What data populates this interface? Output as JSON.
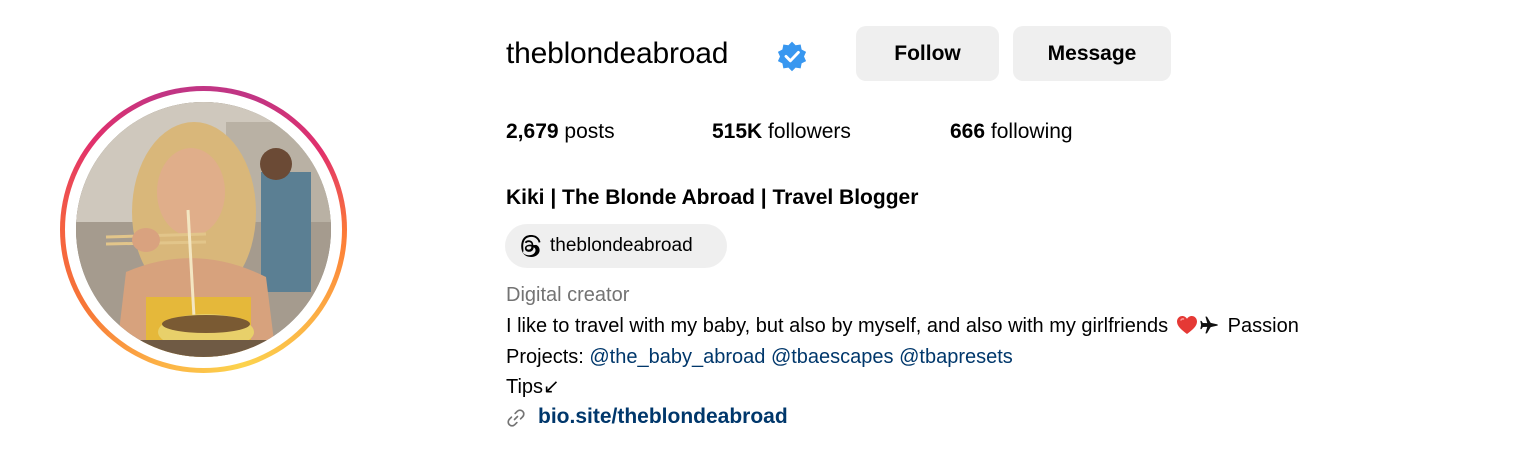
{
  "profile": {
    "username": "theblondeabroad",
    "verified": true,
    "verified_icon": "verified-badge-icon",
    "verified_color": "#3897f0",
    "follow_label": "Follow",
    "message_label": "Message",
    "stats": {
      "posts_count": "2,679",
      "posts_label": "posts",
      "followers_count": "515K",
      "followers_label": "followers",
      "following_count": "666",
      "following_label": "following"
    },
    "full_name": "Kiki | The Blonde Abroad | Travel Blogger",
    "threads": {
      "icon": "threads-icon",
      "handle": "theblondeabroad"
    },
    "category": "Digital creator",
    "bio": {
      "line1_text": "I like to travel with my baby, but also by myself, and also with my girlfriends",
      "line1_suffix": "Passion",
      "line2_prefix": "Projects:",
      "mentions": [
        "@the_baby_abroad",
        "@tbaescapes",
        "@tbapresets"
      ],
      "line3": "Tips↙"
    },
    "link": {
      "icon": "link-icon",
      "text": "bio.site/theblondeabroad"
    },
    "colors": {
      "link": "#00376b",
      "muted": "#737373",
      "button_bg": "#efefef"
    }
  }
}
